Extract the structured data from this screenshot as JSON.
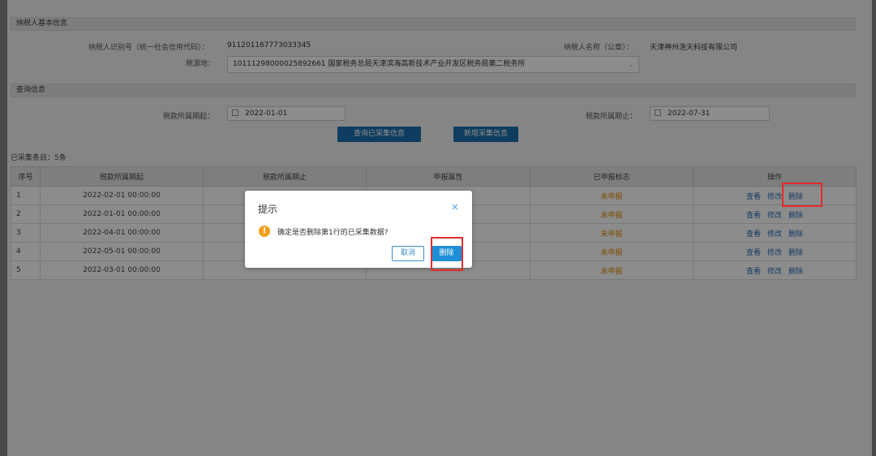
{
  "taxpayer_section": {
    "title": "纳税人基本信息",
    "id_label": "纳税人识别号（统一社会信用代码）：",
    "id_value": "911201167773033345",
    "name_label": "纳税人名称（公章）：",
    "name_value": "天津神州浩天科技有限公司",
    "tax_source_label": "税源地：",
    "tax_source_value": "10111298000025892661 国家税务总局天津滨海高新技术产业开发区税务局第二税务所"
  },
  "query_section": {
    "title": "查询信息",
    "period_start_label": "税款所属期起：",
    "period_start_value": "2022-01-01",
    "period_end_label": "税款所属期止：",
    "period_end_value": "2022-07-31",
    "query_button": "查询已采集信息",
    "add_button": "新增采集信息"
  },
  "record_count": "已采集条目：5条",
  "table": {
    "headers": [
      "序号",
      "税款所属期起",
      "税款所属期止",
      "申报属性",
      "已申报标志",
      "操作"
    ],
    "rows": [
      {
        "seq": "1",
        "start": "2022-02-01 00:00:00",
        "status": "未申报"
      },
      {
        "seq": "2",
        "start": "2022-01-01 00:00:00",
        "status": "未申报"
      },
      {
        "seq": "3",
        "start": "2022-04-01 00:00:00",
        "status": "未申报"
      },
      {
        "seq": "4",
        "start": "2022-05-01 00:00:00",
        "status": "未申报"
      },
      {
        "seq": "5",
        "start": "2022-03-01 00:00:00",
        "status": "未申报"
      }
    ],
    "actions": {
      "view": "查看",
      "edit": "修改",
      "delete": "删除"
    }
  },
  "dialog": {
    "title": "提示",
    "close_glyph": "×",
    "warn_glyph": "!",
    "message": "确定是否删除第1行的已采集数据?",
    "cancel": "取消",
    "confirm": "删除"
  },
  "colors": {
    "primary": "#1a6fae",
    "status_orange": "#e68a00",
    "highlight_red": "#e52b2b"
  }
}
